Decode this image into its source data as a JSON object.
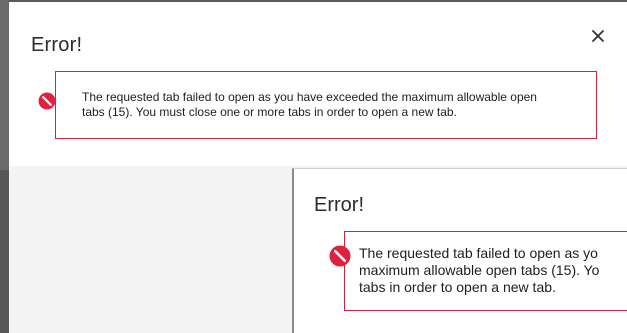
{
  "modal_primary": {
    "title": "Error!",
    "close_icon": "close-icon",
    "alert": {
      "icon": "error-icon",
      "line1": "The requested tab failed to open as you have exceeded the maximum allowable open",
      "line2": "tabs (15). You must close one or more tabs in order to open a new tab."
    }
  },
  "modal_zoomed": {
    "title": "Error!",
    "alert": {
      "icon": "error-icon",
      "line1": "The requested tab failed to open as yo",
      "line2": "maximum allowable open tabs (15). Yo",
      "line3": "tabs in order to open a new tab."
    }
  },
  "colors": {
    "alert_border": "#d9203a",
    "error_icon": "#e0203c"
  }
}
